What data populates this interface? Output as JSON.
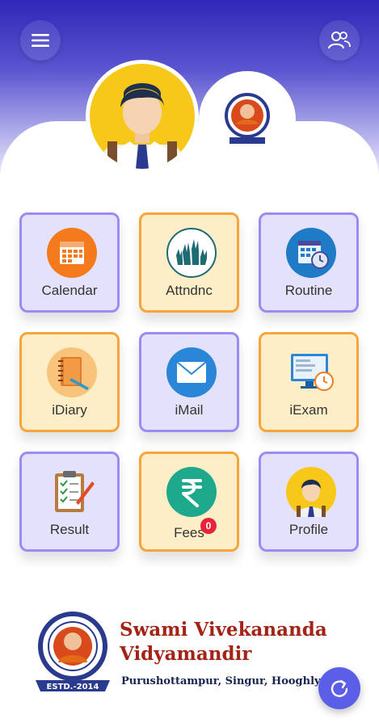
{
  "header": {
    "menu_icon": "menu-icon",
    "users_icon": "users-icon"
  },
  "tiles": [
    {
      "label": "Calendar",
      "icon": "calendar-icon",
      "style": "purple"
    },
    {
      "label": "Attndnc",
      "icon": "attendance-hands-icon",
      "style": "orange"
    },
    {
      "label": "Routine",
      "icon": "routine-schedule-icon",
      "style": "purple"
    },
    {
      "label": "iDiary",
      "icon": "diary-icon",
      "style": "orange"
    },
    {
      "label": "iMail",
      "icon": "mail-icon",
      "style": "purple"
    },
    {
      "label": "iExam",
      "icon": "exam-monitor-icon",
      "style": "orange"
    },
    {
      "label": "Result",
      "icon": "result-clipboard-icon",
      "style": "purple"
    },
    {
      "label": "Fees",
      "icon": "rupee-icon",
      "style": "orange",
      "badge": "0"
    },
    {
      "label": "Profile",
      "icon": "profile-icon",
      "style": "purple"
    }
  ],
  "footer": {
    "school_name_line1": "Swami Vivekananda",
    "school_name_line2": "Vidyamandir",
    "address": "Purushottampur, Singur, Hooghly",
    "logo_text": "ESTD.-2014"
  },
  "colors": {
    "header_top": "#2f27b8",
    "tile_purple_bg": "#e4e2fb",
    "tile_purple_border": "#9a8cf2",
    "tile_orange_bg": "#fdeec7",
    "tile_orange_border": "#f6a53b",
    "school_name": "#a32416",
    "fab": "#5b5ee6"
  },
  "fab_icon": "refresh-icon"
}
